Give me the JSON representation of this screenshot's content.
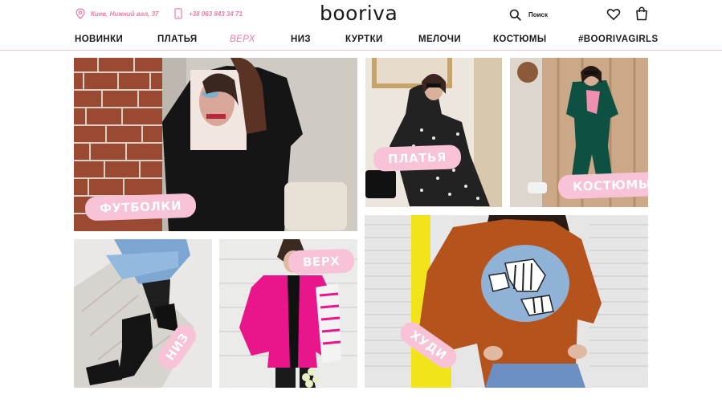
{
  "header": {
    "address": "Киев, Нижний вал, 37",
    "phone": "+38 063 843 34 71",
    "logo": "booriva",
    "search_label": "Поиск",
    "accent_color": "#f07aa6",
    "icons": [
      "location-pin-icon",
      "phone-icon",
      "search-icon",
      "heart-icon",
      "shopping-bag-icon"
    ]
  },
  "nav": {
    "items": [
      {
        "label": "НОВИНКИ"
      },
      {
        "label": "ПЛАТЬЯ"
      },
      {
        "label": "ВЕРХ"
      },
      {
        "label": "НИЗ"
      },
      {
        "label": "КУРТКИ"
      },
      {
        "label": "МЕЛОЧИ"
      },
      {
        "label": "КОСТЮМЫ"
      },
      {
        "label": "#BOORIVAGIRLS"
      }
    ],
    "active_index": 2
  },
  "tiles": {
    "tshirts": {
      "label": "ФУТБОЛКИ"
    },
    "dresses": {
      "label": "ПЛАТЬЯ"
    },
    "suits": {
      "label": "КОСТЮМЫ"
    },
    "bottoms": {
      "label": "НИЗ"
    },
    "tops": {
      "label": "ВЕРХ"
    },
    "hoodies": {
      "label": "ХУДИ"
    }
  },
  "colors": {
    "label_bg": "#f8c3d6",
    "nav_divider": "#f4c3d5"
  }
}
